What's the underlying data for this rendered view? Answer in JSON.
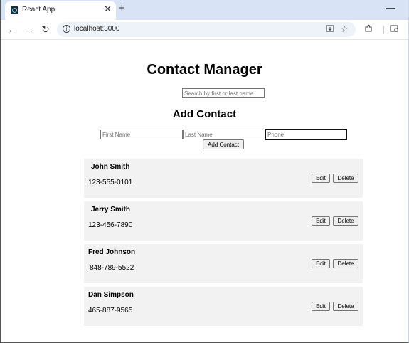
{
  "browser": {
    "tab_title": "React App",
    "tab_close": "✕",
    "new_tab": "+",
    "minimize": "—",
    "url": "localhost:3000",
    "nav": {
      "back": "←",
      "forward": "→",
      "reload": "↻"
    },
    "icons": [
      "info-icon",
      "install-app-icon",
      "bookmark-star-icon",
      "extensions-icon",
      "profile-icon"
    ]
  },
  "page": {
    "title": "Contact Manager",
    "search_placeholder": "Search by first or last name",
    "add_section_title": "Add Contact",
    "form": {
      "first_name_placeholder": "First Name",
      "last_name_placeholder": "Last Name",
      "phone_placeholder": "Phone",
      "add_button": "Add Contact"
    },
    "contacts": [
      {
        "name": "John Smith",
        "phone": "123-555-0101"
      },
      {
        "name": "Jerry Smith",
        "phone": "123-456-7890"
      },
      {
        "name": "Fred Johnson",
        "phone": "848-789-5522"
      },
      {
        "name": "Dan Simpson",
        "phone": "465-887-9565"
      }
    ],
    "edit_label": "Edit",
    "delete_label": "Delete"
  }
}
